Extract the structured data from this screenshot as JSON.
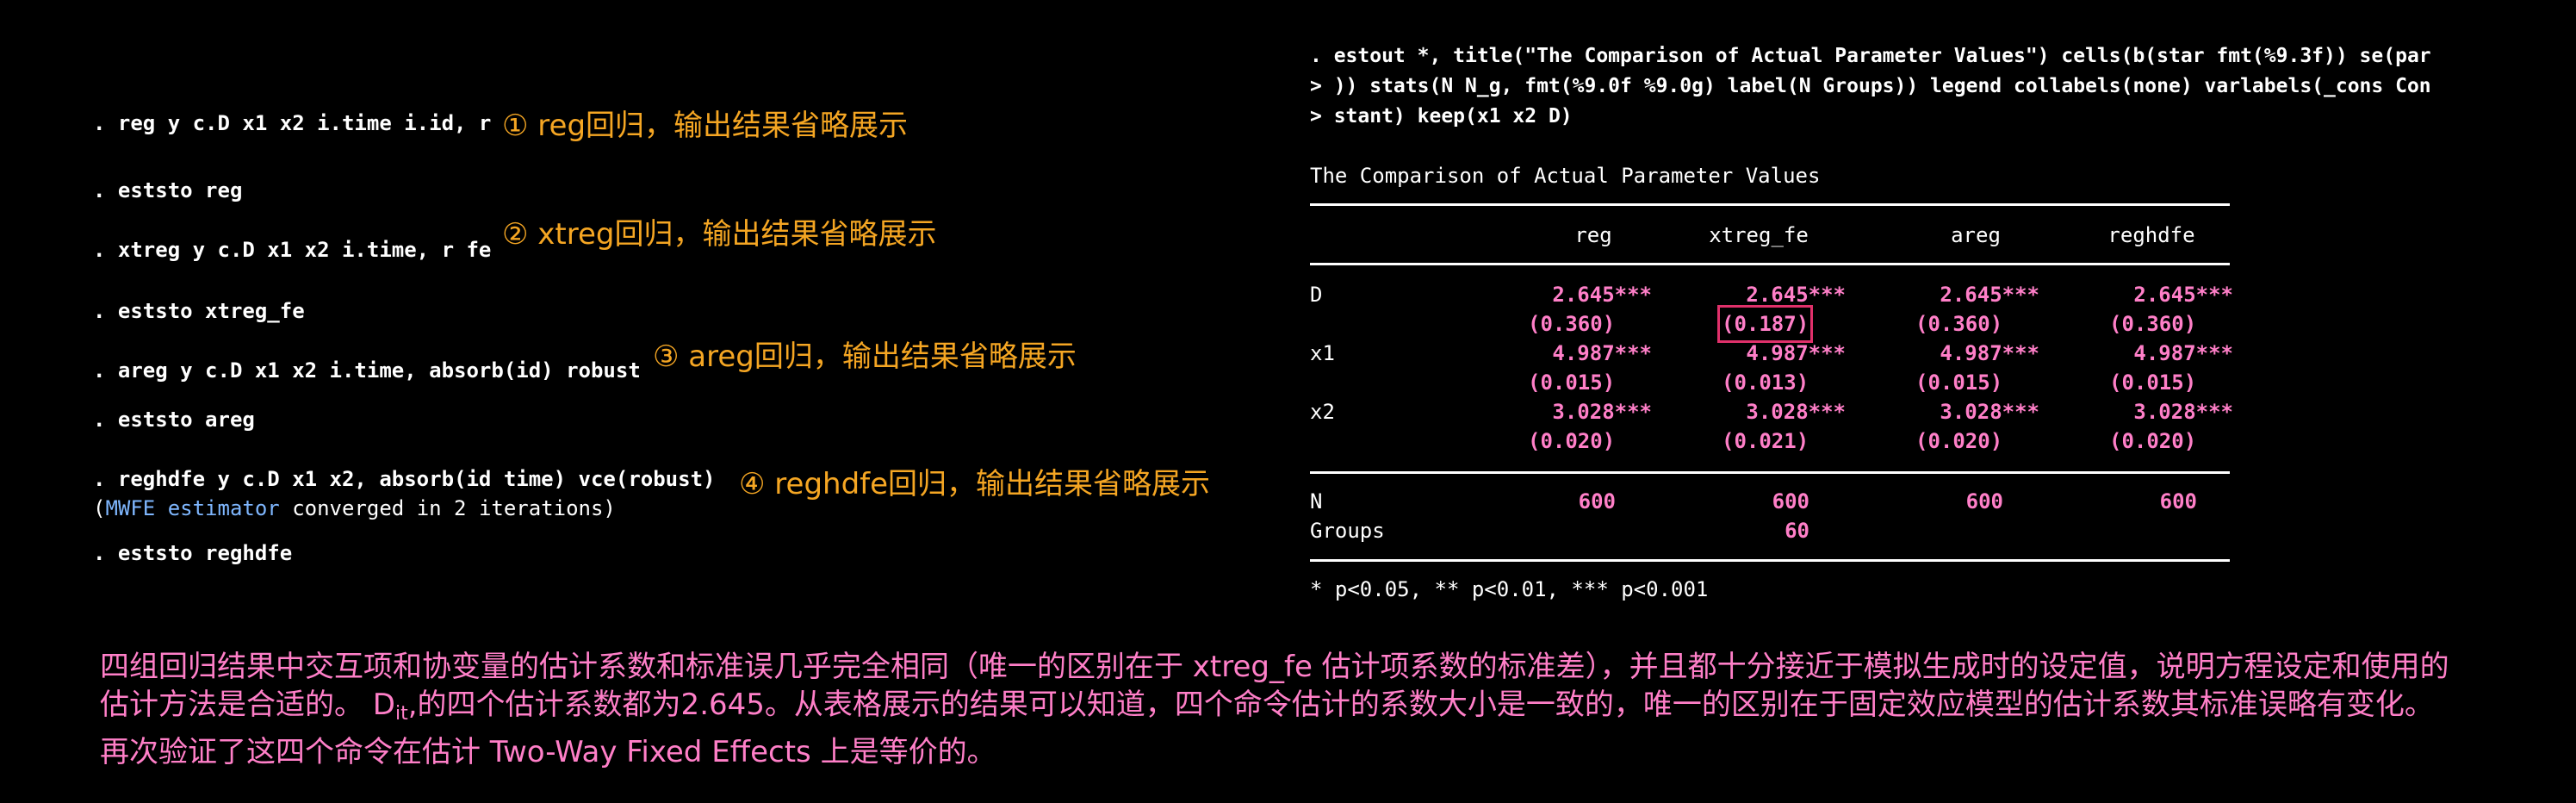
{
  "left_log": {
    "cmd1": ". reg y c.D x1 x2 i.time i.id, r",
    "cmd2": ". eststo reg",
    "cmd3": ". xtreg y c.D x1 x2 i.time, r fe",
    "cmd4": ". eststo xtreg_fe",
    "cmd5": ". areg y c.D x1 x2 i.time, absorb(id) robust",
    "cmd6": ". eststo areg",
    "cmd7": ". reghdfe y c.D x1 x2, absorb(id time) vce(robust)",
    "msg_open": "(",
    "msg_link": "MWFE estimator",
    "msg_rest": " converged in 2 iterations)",
    "cmd8": ". eststo reghdfe"
  },
  "annotations": {
    "a1": "① reg回归，输出结果省略展示",
    "a2": "② xtreg回归，输出结果省略展示",
    "a3": "③ areg回归，输出结果省略展示",
    "a4": "④ reghdfe回归，输出结果省略展示"
  },
  "right_log": {
    "l1": ". estout *, title(\"The Comparison of Actual Parameter Values\") cells(b(star fmt(%9.3f)) se(par",
    "l2": "> )) stats(N N_g, fmt(%9.0f %9.0g) label(N Groups)) legend collabels(none) varlabels(_cons Con",
    "l3": "> stant) keep(x1 x2 D)"
  },
  "table": {
    "title": "The Comparison of Actual Parameter Values",
    "columns": [
      "reg",
      "xtreg_fe",
      "areg",
      "reghdfe"
    ],
    "rows": [
      {
        "label": "D",
        "b": [
          "2.645***",
          "2.645***",
          "2.645***",
          "2.645***"
        ],
        "se": [
          "(0.360)",
          "(0.187)",
          "(0.360)",
          "(0.360)"
        ]
      },
      {
        "label": "x1",
        "b": [
          "4.987***",
          "4.987***",
          "4.987***",
          "4.987***"
        ],
        "se": [
          "(0.015)",
          "(0.013)",
          "(0.015)",
          "(0.015)"
        ]
      },
      {
        "label": "x2",
        "b": [
          "3.028***",
          "3.028***",
          "3.028***",
          "3.028***"
        ],
        "se": [
          "(0.020)",
          "(0.021)",
          "(0.020)",
          "(0.020)"
        ]
      }
    ],
    "stats": {
      "n_label": "N",
      "n_values": [
        "600",
        "600",
        "600",
        "600"
      ],
      "groups_label": "Groups",
      "groups_value": "60"
    },
    "legend": "* p<0.05, ** p<0.01, *** p<0.001"
  },
  "summary": {
    "part1": "四组回归结果中交互项和协变量的估计系数和标准误几乎完全相同（唯一的区别在于 xtreg_fe 估计项系数的标准差），并且都十分接近于模拟生成时的设定值，说明方程设定和使用的估计方法是合适的。 D",
    "sub": "it",
    "part2": ",的四个估计系数都为2.645。从表格展示的结果可以知道，四个命令估计的系数大小是一致的，唯一的区别在于固定效应模型的估计系数其标准误略有变化。再次验证了这四个命令在估计 Two-Way Fixed Effects 上是等价的。"
  },
  "colors": {
    "background": "#000000",
    "annotation": "#f5a623",
    "values": "#ff7fc8",
    "highlight_box": "#e0306a",
    "link": "#7fb7ff"
  }
}
